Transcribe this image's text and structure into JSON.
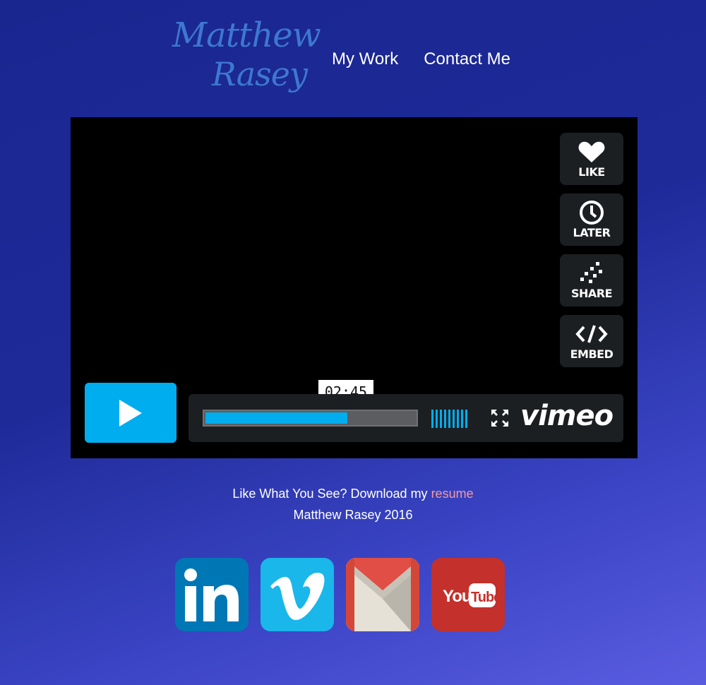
{
  "logo": {
    "line1": "Matthew",
    "line2": "Rasey"
  },
  "nav": {
    "items": [
      "My Work",
      "Contact Me"
    ]
  },
  "player": {
    "side_buttons": [
      {
        "label": "LIKE",
        "icon": "heart-icon"
      },
      {
        "label": "LATER",
        "icon": "clock-icon"
      },
      {
        "label": "SHARE",
        "icon": "share-icon"
      },
      {
        "label": "EMBED",
        "icon": "embed-icon"
      }
    ],
    "time": "02:45",
    "progress_fraction": 0.68,
    "brand": "vimeo",
    "accent_color": "#00adef"
  },
  "footer": {
    "line1_prefix": "Like What You See? Download my ",
    "resume_link": "resume",
    "line2": "Matthew Rasey 2016"
  },
  "social": {
    "items": [
      {
        "name": "linkedin",
        "text": "in"
      },
      {
        "name": "vimeo",
        "text": "v"
      },
      {
        "name": "gmail"
      },
      {
        "name": "youtube",
        "text_you": "You",
        "text_tube": "Tube"
      }
    ]
  }
}
